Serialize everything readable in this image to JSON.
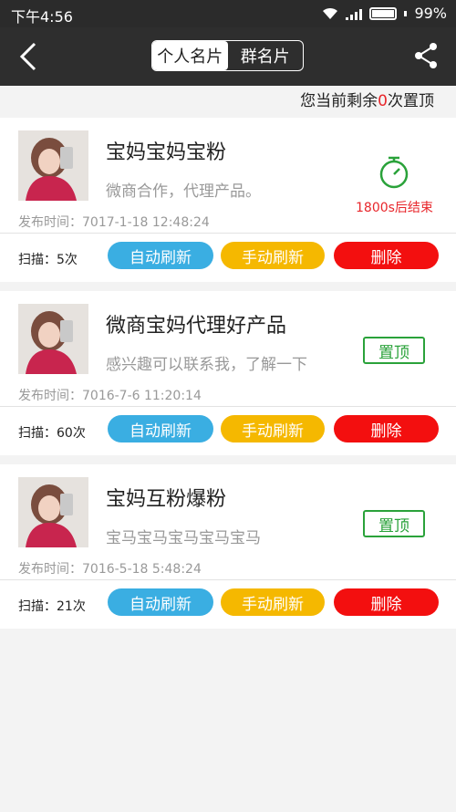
{
  "status_bar": {
    "time": "下午4:56",
    "battery": "99%"
  },
  "header": {
    "tabs": [
      "个人名片",
      "群名片"
    ],
    "active_tab": 0
  },
  "remaining": {
    "prefix": "您当前剩余",
    "count": "0",
    "suffix": "次置顶"
  },
  "cards": [
    {
      "title": "宝妈宝妈宝粉",
      "desc": "微商合作，代理产品。",
      "time": "发布时间：7017-1-18    12:48:24",
      "scan": "扫描：5次",
      "timer_text": "1800s后结束"
    },
    {
      "title": "微商宝妈代理好产品",
      "desc": "感兴趣可以联系我，了解一下",
      "time": "发布时间：7016-7-6    11:20:14",
      "scan": "扫描：60次",
      "top_label": "置顶"
    },
    {
      "title": "宝妈互粉爆粉",
      "desc": "宝马宝马宝马宝马宝马",
      "time": "发布时间：7016-5-18    5:48:24",
      "scan": "扫描：21次",
      "top_label": "置顶"
    }
  ],
  "actions": {
    "auto": "自动刷新",
    "manual": "手动刷新",
    "delete": "删除"
  },
  "colors": {
    "accent_red": "#e8262b",
    "auto_blue": "#3aaee2",
    "manual_yellow": "#f5b800",
    "delete_red": "#f30f0f",
    "green": "#2aa23a"
  }
}
